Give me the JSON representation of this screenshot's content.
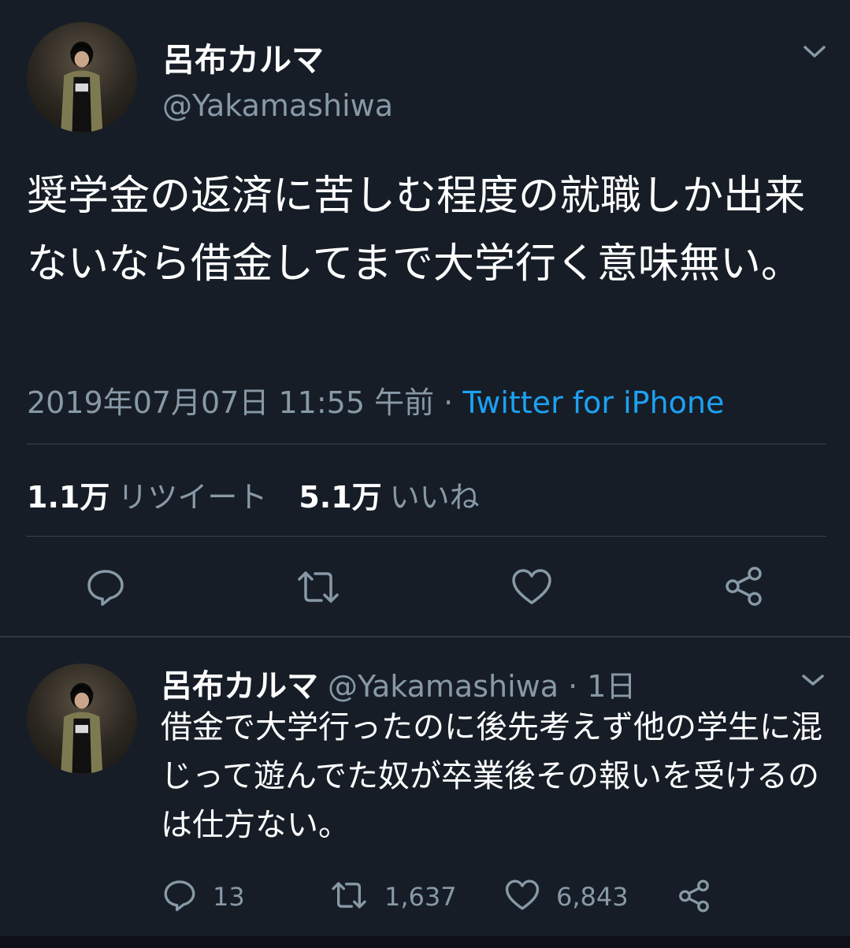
{
  "main_tweet": {
    "display_name": "呂布カルマ",
    "handle": "@Yakamashiwa",
    "text": "奨学金の返済に苦しむ程度の就職しか出来ないなら借金してまで大学行く意味無い。",
    "timestamp": "2019年07月07日 11:55 午前 · ",
    "source": "Twitter for iPhone",
    "retweet_count": "1.1万",
    "retweet_label": "リツイート",
    "like_count": "5.1万",
    "like_label": "いいね",
    "icons": [
      "reply-icon",
      "retweet-icon",
      "like-icon",
      "share-icon",
      "chevron-down-icon"
    ]
  },
  "reply_tweet": {
    "display_name": "呂布カルマ",
    "handle_time": "@Yakamashiwa · 1日",
    "text": "借金で大学行ったのに後先考えず他の学生に混じって遊んでた奴が卒業後その報いを受けるのは仕方ない。",
    "reply_count": "13",
    "retweet_count": "1,637",
    "like_count": "6,843"
  },
  "colors": {
    "background": "#161d27",
    "secondary_text": "#8899a6",
    "link": "#1da1f2",
    "divider": "#38444d"
  }
}
